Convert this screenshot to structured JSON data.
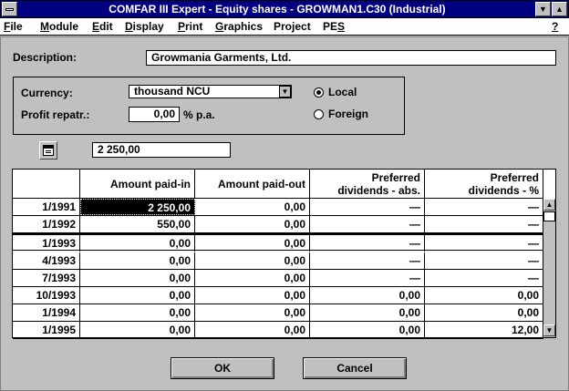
{
  "window": {
    "title": "COMFAR III Expert - Equity shares - GROWMAN1.C30 (Industrial)"
  },
  "icons": {
    "system": "system-menu-icon",
    "minimize": "triangle-down-icon",
    "maximize": "triangle-up-icon",
    "dropdown": "dropdown-arrow-icon",
    "calculator": "edit-window-icon",
    "scroll_up": "scroll-up-arrow-icon",
    "scroll_down": "scroll-down-arrow-icon"
  },
  "menu": [
    {
      "label": "File",
      "key": "F"
    },
    {
      "label": "Module",
      "key": "M"
    },
    {
      "label": "Edit",
      "key": "E"
    },
    {
      "label": "Display",
      "key": "D"
    },
    {
      "label": "Print",
      "key": "P"
    },
    {
      "label": "Graphics",
      "key": "G"
    },
    {
      "label": "Project",
      "key": "j"
    },
    {
      "label": "PES",
      "key": "S"
    },
    {
      "label": "?",
      "key": "?"
    }
  ],
  "form": {
    "description_label": "Description:",
    "description_value": "Growmania Garments, Ltd.",
    "currency_label": "Currency:",
    "currency_value": "thousand NCU",
    "repatr_label": "Profit repatr.:",
    "repatr_value": "0,00",
    "repatr_unit": "% p.a.",
    "radio_local": "Local",
    "radio_foreign": "Foreign",
    "selected_radio": "Local",
    "edit_value": "2 250,00"
  },
  "table": {
    "headers": [
      "",
      "Amount paid-in",
      "Amount paid-out",
      "Preferred dividends - abs.",
      "Preferred dividends - %"
    ],
    "header_lines": [
      [
        "",
        ""
      ],
      [
        "",
        "Amount paid-in"
      ],
      [
        "",
        "Amount paid-out"
      ],
      [
        "Preferred",
        "dividends - abs."
      ],
      [
        "Preferred",
        "dividends - %"
      ]
    ],
    "rows": [
      [
        "1/1991",
        "2  250,00",
        "0,00",
        "—",
        "—"
      ],
      [
        "1/1992",
        "550,00",
        "0,00",
        "—",
        "—"
      ],
      [
        "1/1993",
        "0,00",
        "0,00",
        "—",
        "—"
      ],
      [
        "4/1993",
        "0,00",
        "0,00",
        "—",
        "—"
      ],
      [
        "7/1993",
        "0,00",
        "0,00",
        "—",
        "—"
      ],
      [
        "10/1993",
        "0,00",
        "0,00",
        "0,00",
        "0,00"
      ],
      [
        "1/1994",
        "0,00",
        "0,00",
        "0,00",
        "0,00"
      ],
      [
        "1/1995",
        "0,00",
        "0,00",
        "0,00",
        "12,00"
      ]
    ]
  },
  "buttons": {
    "ok": "OK",
    "cancel": "Cancel"
  }
}
